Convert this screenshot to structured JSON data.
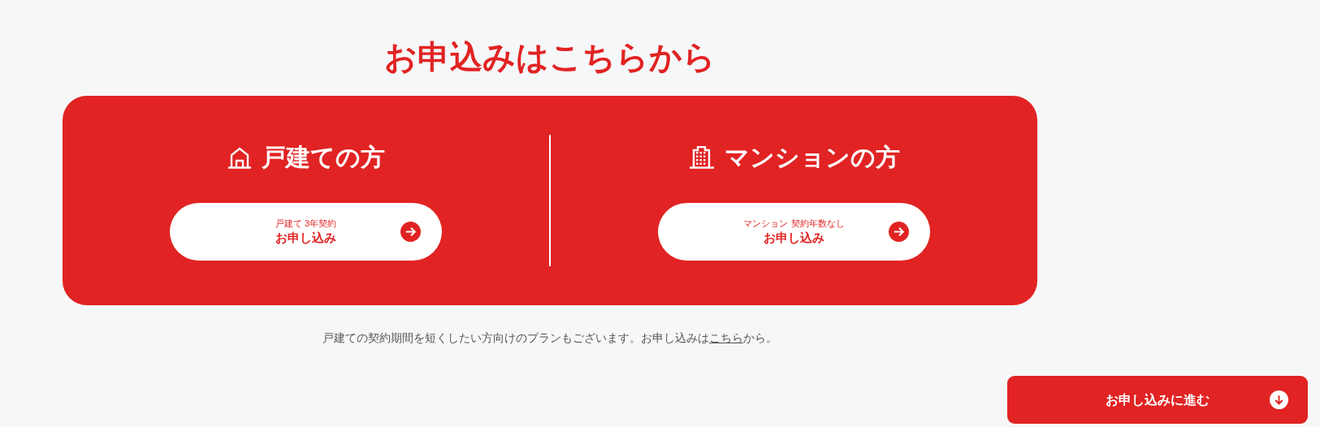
{
  "title": "お申込みはこちらから",
  "plans": [
    {
      "kind": "house",
      "heading": "戸建ての方",
      "button": {
        "sub": "戸建て 3年契約",
        "label": "お申し込み"
      }
    },
    {
      "kind": "building",
      "heading": "マンションの方",
      "button": {
        "sub": "マンション 契約年数なし",
        "label": "お申し込み"
      }
    }
  ],
  "note": {
    "before": "戸建ての契約期間を短くしたい方向けのプランもございます。お申し込みは",
    "link": "こちら",
    "after": "から。"
  },
  "floating_button": {
    "label": "お申し込みに進む"
  }
}
